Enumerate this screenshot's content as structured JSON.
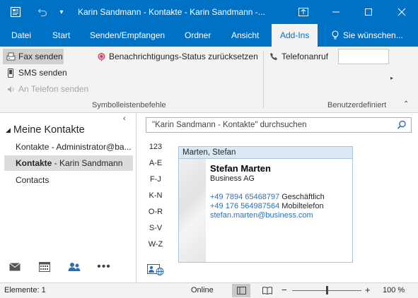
{
  "window": {
    "title": "Karin Sandmann - Kontakte - Karin Sandmann  -...",
    "quick_access": [
      "app-icon",
      "undo-icon",
      "customize-dropdown-icon"
    ],
    "controls": [
      "ribbon-display-icon",
      "minimize-icon",
      "maximize-icon",
      "close-icon"
    ]
  },
  "tabs": [
    {
      "label": "Datei"
    },
    {
      "label": "Start"
    },
    {
      "label": "Senden/Empfangen"
    },
    {
      "label": "Ordner"
    },
    {
      "label": "Ansicht"
    },
    {
      "label": "Add-Ins",
      "active": true
    }
  ],
  "tell_me": {
    "label": "Sie wünschen..."
  },
  "ribbon": {
    "fax": "Fax senden",
    "sms": "SMS senden",
    "call": "An Telefon senden",
    "reset": "Benachrichtigungs-Status zurücksetzen",
    "group1": "Symbolleistenbefehle",
    "phone": "Telefonanruf",
    "phone_value": "",
    "group2": "Benutzerdefiniert"
  },
  "folders": {
    "heading": "Meine Kontakte",
    "items": [
      {
        "label": "Kontakte - Administrator@ba..."
      },
      {
        "bold": "Kontakte",
        "rest": " - Karin Sandmann",
        "selected": true
      },
      {
        "label": "Contacts"
      }
    ]
  },
  "nav": [
    "mail-icon",
    "calendar-icon",
    "people-icon",
    "more-icon"
  ],
  "search": {
    "placeholder": "\"Karin Sandmann - Kontakte\" durchsuchen"
  },
  "index": [
    "123",
    "A-E",
    "F-J",
    "K-N",
    "O-R",
    "S-V",
    "W-Z"
  ],
  "card": {
    "header": "Marten, Stefan",
    "name": "Stefan Marten",
    "company": "Business AG",
    "phone_business": "+49 7894 65468797",
    "phone_business_label": "Geschäftlich",
    "phone_mobile": "+49 176 564987564",
    "phone_mobile_label": "Mobiltelefon",
    "email": "stefan.marten@business.com"
  },
  "status": {
    "items": "Elemente: 1",
    "connection": "Online",
    "zoom": "100 %",
    "zoom_level": 1.0
  },
  "colors": {
    "accent": "#0072c6",
    "link": "#2a6fb5",
    "card_header": "#dce9f5"
  }
}
